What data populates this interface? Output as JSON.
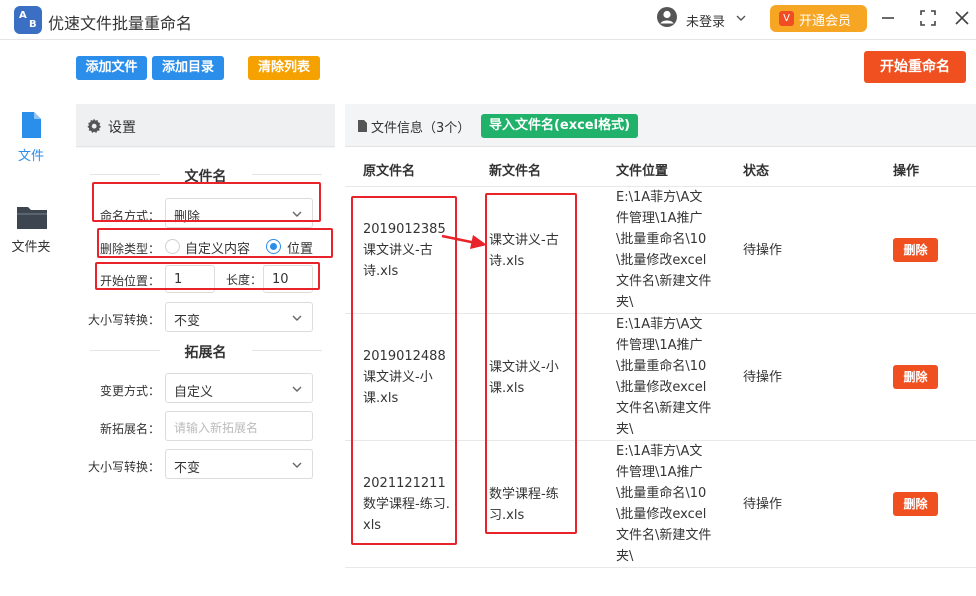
{
  "app": {
    "title": "优速文件批量重命名",
    "logo_letters": [
      "A",
      "B"
    ]
  },
  "header": {
    "user_icon": "user-circle-icon",
    "user_label": "未登录",
    "vip_badge": "V",
    "vip_label": "开通会员",
    "window_controls": [
      "minimize-icon",
      "fullscreen-icon",
      "close-icon"
    ]
  },
  "toolbar": {
    "add_file": "添加文件",
    "add_dir": "添加目录",
    "clear_list": "清除列表",
    "start_rename": "开始重命名"
  },
  "sidebar": {
    "items": [
      {
        "label": "文件",
        "icon": "file-icon",
        "active": true
      },
      {
        "label": "文件夹",
        "icon": "folder-icon",
        "active": false
      }
    ]
  },
  "settings": {
    "title": "设置",
    "filename_section": "文件名",
    "naming_mode_label": "命名方式：",
    "naming_mode_value": "删除",
    "delete_type_label": "删除类型：",
    "delete_type_options": [
      "自定义内容",
      "位置"
    ],
    "delete_type_selected": "位置",
    "start_pos_label": "开始位置：",
    "start_pos_value": "1",
    "length_label": "长度：",
    "length_value": "10",
    "case_label": "大小写转换：",
    "case_value": "不变",
    "ext_section": "拓展名",
    "change_mode_label": "变更方式：",
    "change_mode_value": "自定义",
    "new_ext_label": "新拓展名：",
    "new_ext_placeholder": "请输入新拓展名",
    "ext_case_label": "大小写转换：",
    "ext_case_value": "不变"
  },
  "files": {
    "title": "文件信息（3个）",
    "import_label": "导入文件名(excel格式)",
    "columns": [
      "原文件名",
      "新文件名",
      "文件位置",
      "状态",
      "操作"
    ],
    "rows": [
      {
        "original": "2019012385课文讲义-古诗.xls",
        "new": "课文讲义-古诗.xls",
        "location": "E:\\1A菲方\\A文件管理\\1A推广\\批量重命名\\10\\批量修改excel文件名\\新建文件夹\\",
        "status": "待操作",
        "action": "删除"
      },
      {
        "original": "2019012488课文讲义-小课.xls",
        "new": "课文讲义-小课.xls",
        "location": "E:\\1A菲方\\A文件管理\\1A推广\\批量重命名\\10\\批量修改excel文件名\\新建文件夹\\",
        "status": "待操作",
        "action": "删除"
      },
      {
        "original": "2021121211数学课程-练习.xls",
        "new": "数学课程-练习.xls",
        "location": "E:\\1A菲方\\A文件管理\\1A推广\\批量重命名\\10\\批量修改excel文件名\\新建文件夹\\",
        "status": "待操作",
        "action": "删除"
      }
    ]
  },
  "colors": {
    "accent_blue": "#2b8eea",
    "accent_red": "#f0501f",
    "accent_orange": "#f5a100",
    "accent_green": "#20b26b",
    "annotation_red": "#e8242a"
  }
}
